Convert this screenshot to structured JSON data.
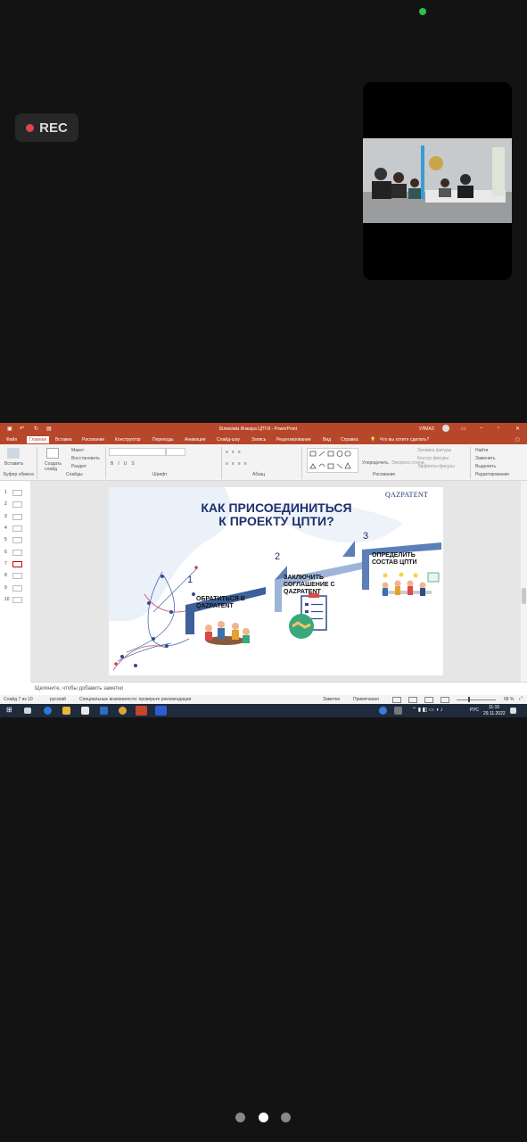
{
  "overlay": {
    "rec_label": "REC"
  },
  "window": {
    "title": "Бiлiмсiмiз Инжара ЦПТИ - PowerPoint",
    "user": "УЛМАЗ"
  },
  "ribbon_tabs": [
    "Файл",
    "Главная",
    "Вставка",
    "Рисование",
    "Конструктор",
    "Переходы",
    "Анимация",
    "Слайд-шоу",
    "Запись",
    "Рецензирование",
    "Вид",
    "Справка"
  ],
  "active_tab": "Главная",
  "tell_me": "Что вы хотите сделать?",
  "ribbon": {
    "groups": [
      "Буфер обмена",
      "Слайды",
      "Шрифт",
      "Абзац",
      "Рисование",
      "Редактирование"
    ],
    "paste": "Вставить",
    "create_slide": "Создать слайд",
    "layout": "Макет",
    "reset": "Восстановить",
    "section": "Раздел",
    "arrange": "Упорядочить",
    "quick_styles": "Экспресс-стили",
    "shape_fill": "Заливка фигуры",
    "shape_outline": "Контур фигуры",
    "shape_effects": "Эффекты фигуры",
    "find": "Найти",
    "replace": "Заменить",
    "select": "Выделить"
  },
  "thumbnails": [
    "1",
    "2",
    "3",
    "4",
    "5",
    "6",
    "7",
    "8",
    "9",
    "10"
  ],
  "current_slide": "7",
  "slide": {
    "title_line1": "КАК ПРИСОЕДИНИТЬСЯ",
    "title_line2": "К ПРОЕКТУ ЦПТИ?",
    "logo": "QAZPATENT",
    "steps": [
      {
        "num": "1",
        "line1": "ОБРАТИТЬСЯ В",
        "line2": "QAZPATENT"
      },
      {
        "num": "2",
        "line1": "ЗАКЛЮЧИТЬ",
        "line2": "СОГЛАШЕНИЕ С",
        "line3": "QAZPATENT"
      },
      {
        "num": "3",
        "line1": "ОПРЕДЕЛИТЬ",
        "line2": "СОСТАВ ЦПТИ"
      }
    ]
  },
  "notes_placeholder": "Щелкните, чтобы добавить заметки",
  "status": {
    "slide_of": "Слайд 7 из 10",
    "language": "русский",
    "accessibility": "Специальные возможности: проверьте рекомендации",
    "notes": "Заметки",
    "comments": "Примечания",
    "zoom": "68 %"
  },
  "taskbar": {
    "lang": "РУС",
    "time": "11:15",
    "date": "29.11.2022"
  },
  "page_indicator": {
    "count": 3,
    "active": 2
  },
  "colors": {
    "powerpoint_red": "#b7472a",
    "slide_navy": "#1e2f6e",
    "step_blue": "#5b7fb6",
    "rec_red": "#e04646"
  }
}
